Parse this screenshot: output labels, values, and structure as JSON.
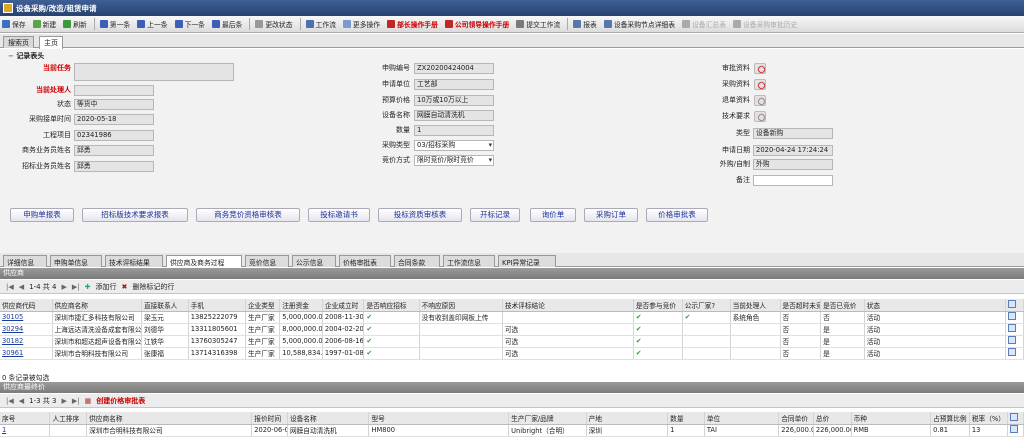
{
  "window_title": "设备采购/改造/租赁申请",
  "toolbar": [
    {
      "label": "保存",
      "icon": "save-icon",
      "color": "#3a6fc4",
      "style": ""
    },
    {
      "label": "新建",
      "icon": "new-icon",
      "color": "#59a34a",
      "style": ""
    },
    {
      "label": "刷新",
      "icon": "refresh-icon",
      "color": "#3a9a3a",
      "style": ""
    },
    {
      "label": "第一条",
      "icon": "first-icon",
      "color": "#3a5fb4",
      "style": ""
    },
    {
      "label": "上一条",
      "icon": "prev-icon",
      "color": "#3a5fb4",
      "style": ""
    },
    {
      "label": "下一条",
      "icon": "next-icon",
      "color": "#3a5fb4",
      "style": ""
    },
    {
      "label": "最后条",
      "icon": "last-icon",
      "color": "#3a5fb4",
      "style": ""
    },
    {
      "label": "更改状态",
      "icon": "status-icon",
      "color": "#999",
      "style": ""
    },
    {
      "label": "工作流",
      "icon": "workflow-icon",
      "color": "#4a70b0",
      "style": ""
    },
    {
      "label": "更多操作",
      "icon": "more-icon",
      "color": "#7a9ad0",
      "style": ""
    },
    {
      "label": "部长操作手册",
      "icon": "manual-icon",
      "color": "#c02828",
      "style": "red"
    },
    {
      "label": "公司领导操作手册",
      "icon": "manual-icon",
      "color": "#c02828",
      "style": "red"
    },
    {
      "label": "提交工作流",
      "icon": "submit-icon",
      "color": "#7a7a7a",
      "style": ""
    },
    {
      "label": "报表",
      "icon": "report-icon",
      "color": "#5577aa",
      "style": ""
    },
    {
      "label": "设备采购节点详细表",
      "icon": "node-icon",
      "color": "#5577aa",
      "style": ""
    },
    {
      "label": "设备汇总表",
      "icon": "summary-icon",
      "color": "#aaa",
      "style": "dis"
    },
    {
      "label": "设备采购审批历史",
      "icon": "history-icon",
      "color": "#aaa",
      "style": "dis"
    }
  ],
  "page_tabs": [
    "搜索页",
    "主页"
  ],
  "section_title": "记录表头",
  "left_fields": [
    {
      "label": "当前任务",
      "value": "",
      "req": true
    },
    {
      "label": "当前处理人",
      "value": "",
      "req": true
    },
    {
      "label": "状态",
      "value": "等货中",
      "req": false
    },
    {
      "label": "采购接单时间",
      "value": "2020-05-18",
      "req": false
    },
    {
      "label": "工程项目",
      "value": "02341986",
      "req": false
    },
    {
      "label": "商务业务员姓名",
      "value": "邱勇",
      "req": false
    },
    {
      "label": "招标业务员姓名",
      "value": "邱勇",
      "req": false
    }
  ],
  "mid_fields": [
    {
      "label": "申购编号",
      "value": "ZX20200424004"
    },
    {
      "label": "申请单位",
      "value": "工艺部"
    },
    {
      "label": "预算价格",
      "value": "10万或10万以上"
    },
    {
      "label": "设备名称",
      "value": "网膜自动清洗机"
    },
    {
      "label": "数量",
      "value": "1"
    },
    {
      "label": "采购类型",
      "value": "03/招标采购"
    },
    {
      "label": "竞价方式",
      "value": "限时竞价/限时竞价"
    }
  ],
  "right_attach": [
    "审批资料",
    "采购资料",
    "退单资料",
    "技术要求"
  ],
  "right_fields": [
    {
      "label": "类型",
      "value": "设备新购"
    },
    {
      "label": "申请日期",
      "value": "2020-04-24 17:24:24"
    },
    {
      "label": "外购/自制",
      "value": "外购"
    },
    {
      "label": "备注",
      "value": ""
    }
  ],
  "action_buttons": [
    "申购单报表",
    "招标版技术要求报表",
    "商务竞价资格审核表",
    "投标邀请书",
    "投标资质审核表",
    "开标记录",
    "询价单",
    "采购订单",
    "价格审批表"
  ],
  "detail_tabs": [
    "详细信息",
    "申购单信息",
    "技术评标结果",
    "供应商及商务过程",
    "竞价信息",
    "公示信息",
    "价格审批表",
    "合同条款",
    "工作流信息",
    "KPI异常记录"
  ],
  "suppliers": {
    "title": "供应商",
    "pager": "1-4 共 4",
    "add_row": "添加行",
    "delete_row": "删除标记的行",
    "columns": [
      "供应商代码",
      "供应商名称",
      "直接联系人",
      "手机",
      "企业类型",
      "注册资金",
      "企业成立时",
      "是否响应招标",
      "不响应原因",
      "技术评标结论",
      "是否参与竞价",
      "公示厂家?",
      "当前处理人",
      "是否超时未竞价",
      "是否已竞价",
      "状态"
    ],
    "rows": [
      [
        "30105",
        "深圳市捷汇多科技有限公司",
        "梁玉元",
        "13825222079",
        "生产厂家",
        "5,000,000.00",
        "2008-11-30",
        "✔",
        "没有收到盖印网板上传",
        "",
        "✔",
        "✔",
        "系统角色",
        "否",
        "否",
        "活动"
      ],
      [
        "30294",
        "上海远达清洗设备成套有限公司",
        "刘德华",
        "13311805601",
        "生产厂家",
        "8,000,000.00",
        "2004-02-20",
        "✔",
        "",
        "可选",
        "✔",
        "",
        "",
        "否",
        "是",
        "活动"
      ],
      [
        "30182",
        "深圳市和超达超声设备有限公司",
        "江铁华",
        "13760305247",
        "生产厂家",
        "5,000,000.00",
        "2006-08-16",
        "✔",
        "",
        "可选",
        "✔",
        "",
        "",
        "否",
        "是",
        "活动"
      ],
      [
        "30961",
        "深圳市合明科技有限公司",
        "张康福",
        "13714316398",
        "生产厂家",
        "10,588,834.00",
        "1997-01-08",
        "✔",
        "",
        "可选",
        "✔",
        "",
        "",
        "否",
        "是",
        "活动"
      ]
    ],
    "footer": "0 条记录被勾选"
  },
  "final_price": {
    "title": "供应商最终价",
    "pager": "1-3 共 3",
    "create_label": "创建价格审批表",
    "columns": [
      "序号",
      "人工排序",
      "供应商名称",
      "报价时间",
      "设备名称",
      "型号",
      "生产厂家/品牌",
      "产地",
      "数量",
      "单位",
      "合同单价",
      "总价",
      "币种",
      "占预算比例",
      "税率（%）"
    ],
    "rows": [
      [
        "1",
        "",
        "深圳市合明科技有限公司",
        "2020-06-01",
        "网膜自动清洗机",
        "HM800",
        "Unibright（合明）",
        "深圳",
        "1",
        "TAI",
        "226,000.00",
        "226,000.00",
        "RMB",
        "0.81",
        "13"
      ]
    ]
  }
}
